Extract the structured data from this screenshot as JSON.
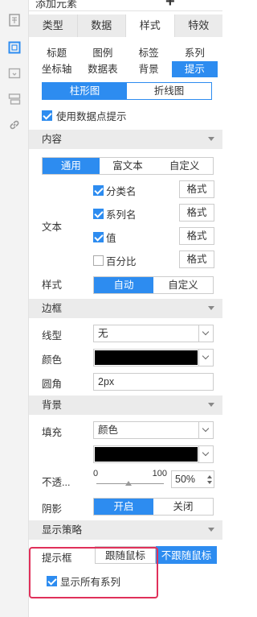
{
  "rail": {
    "icons": [
      "grid-doc-icon",
      "square-icon",
      "window-icon",
      "layers-icon",
      "link-icon"
    ]
  },
  "add_element": {
    "label": "添加元素",
    "plus": "+"
  },
  "main_tabs": [
    {
      "label": "类型",
      "active": false
    },
    {
      "label": "数据",
      "active": false
    },
    {
      "label": "样式",
      "active": true
    },
    {
      "label": "特效",
      "active": false
    }
  ],
  "sub_tabs": {
    "row1": [
      {
        "label": "标题",
        "active": false
      },
      {
        "label": "图例",
        "active": false
      },
      {
        "label": "标签",
        "active": false
      },
      {
        "label": "系列",
        "active": false
      }
    ],
    "row2": [
      {
        "label": "坐标轴",
        "active": false
      },
      {
        "label": "数据表",
        "active": false
      },
      {
        "label": "背景",
        "active": false
      },
      {
        "label": "提示",
        "active": true
      }
    ]
  },
  "chart_toggle": {
    "bar": "柱形图",
    "line": "折线图",
    "selected": "bar"
  },
  "use_tip": {
    "label": "使用数据点提示",
    "checked": true
  },
  "sections": {
    "content": "内容",
    "border": "边框",
    "background": "背景",
    "strategy": "显示策略"
  },
  "content_tabs": {
    "general": "通用",
    "rich": "富文本",
    "custom": "自定义"
  },
  "text": {
    "label": "文本",
    "items": [
      {
        "label": "分类名",
        "checked": true,
        "format": "格式"
      },
      {
        "label": "系列名",
        "checked": true,
        "format": "格式"
      },
      {
        "label": "值",
        "checked": true,
        "format": "格式"
      },
      {
        "label": "百分比",
        "checked": false,
        "format": "格式"
      }
    ]
  },
  "style": {
    "label": "样式",
    "auto": "自动",
    "custom": "自定义"
  },
  "border": {
    "line_label": "线型",
    "line_value": "无",
    "color_label": "颜色",
    "color_value": "#000000",
    "radius_label": "圆角",
    "radius_value": "2px"
  },
  "background": {
    "fill_label": "填充",
    "fill_value": "颜色",
    "fill_color": "#000000",
    "opacity_label": "不透...",
    "slider_min": "0",
    "slider_max": "100",
    "opacity_value": "50%",
    "shadow_label": "阴影",
    "shadow_on": "开启",
    "shadow_off": "关闭"
  },
  "strategy": {
    "tipbox_label": "提示框",
    "follow": "跟随鼠标",
    "no_follow": "不跟随鼠标",
    "show_all": "显示所有系列",
    "show_all_checked": true
  },
  "colors": {
    "accent": "#2d8cf0",
    "highlight": "#e0305a"
  }
}
